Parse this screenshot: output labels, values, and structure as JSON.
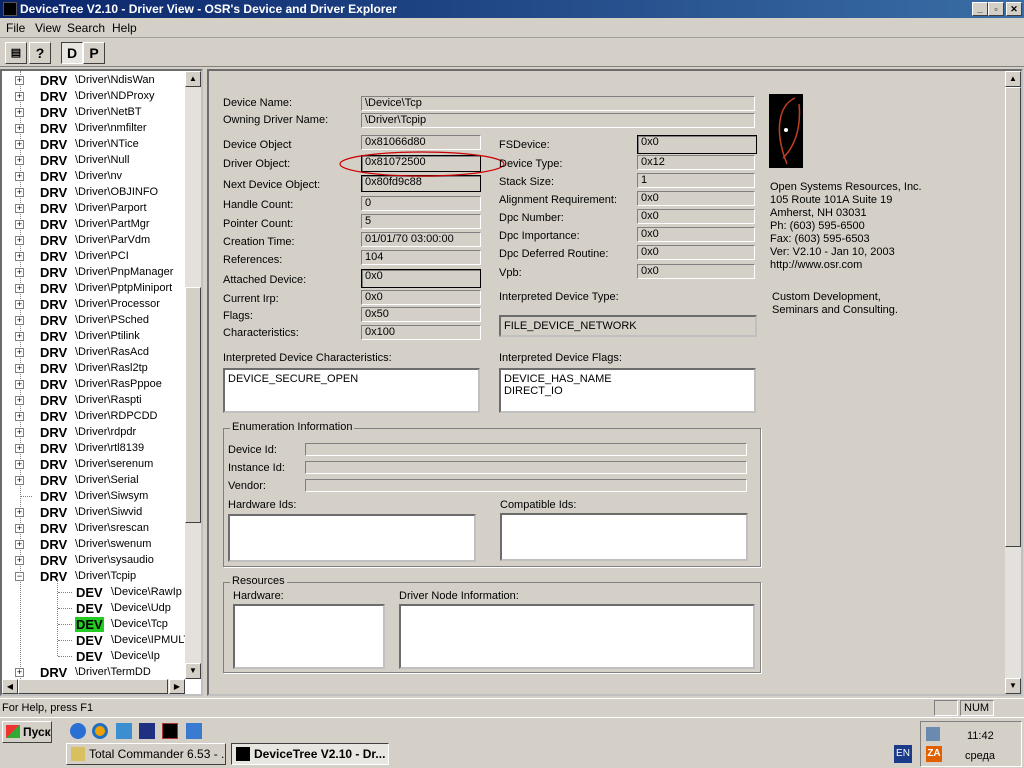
{
  "window": {
    "title": "DeviceTree V2.10 - Driver View - OSR's Device and Driver Explorer"
  },
  "menu": [
    "File",
    "View",
    "Search",
    "Help"
  ],
  "toolbar": {
    "d_label": "D",
    "p_label": "P"
  },
  "tree": {
    "drivers": [
      {
        "kind": "DRV",
        "name": "\\Driver\\NdisWan"
      },
      {
        "kind": "DRV",
        "name": "\\Driver\\NDProxy"
      },
      {
        "kind": "DRV",
        "name": "\\Driver\\NetBT"
      },
      {
        "kind": "DRV",
        "name": "\\Driver\\nmfilter"
      },
      {
        "kind": "DRV",
        "name": "\\Driver\\NTice"
      },
      {
        "kind": "DRV",
        "name": "\\Driver\\Null"
      },
      {
        "kind": "DRV",
        "name": "\\Driver\\nv"
      },
      {
        "kind": "DRV",
        "name": "\\Driver\\OBJINFO"
      },
      {
        "kind": "DRV",
        "name": "\\Driver\\Parport"
      },
      {
        "kind": "DRV",
        "name": "\\Driver\\PartMgr"
      },
      {
        "kind": "DRV",
        "name": "\\Driver\\ParVdm"
      },
      {
        "kind": "DRV",
        "name": "\\Driver\\PCI"
      },
      {
        "kind": "DRV",
        "name": "\\Driver\\PnpManager"
      },
      {
        "kind": "DRV",
        "name": "\\Driver\\PptpMiniport"
      },
      {
        "kind": "DRV",
        "name": "\\Driver\\Processor"
      },
      {
        "kind": "DRV",
        "name": "\\Driver\\PSched"
      },
      {
        "kind": "DRV",
        "name": "\\Driver\\Ptilink"
      },
      {
        "kind": "DRV",
        "name": "\\Driver\\RasAcd"
      },
      {
        "kind": "DRV",
        "name": "\\Driver\\Rasl2tp"
      },
      {
        "kind": "DRV",
        "name": "\\Driver\\RasPppoe"
      },
      {
        "kind": "DRV",
        "name": "\\Driver\\Raspti"
      },
      {
        "kind": "DRV",
        "name": "\\Driver\\RDPCDD"
      },
      {
        "kind": "DRV",
        "name": "\\Driver\\rdpdr"
      },
      {
        "kind": "DRV",
        "name": "\\Driver\\rtl8139"
      },
      {
        "kind": "DRV",
        "name": "\\Driver\\serenum"
      },
      {
        "kind": "DRV",
        "name": "\\Driver\\Serial"
      },
      {
        "kind": "DRV",
        "name": "\\Driver\\Siwsym"
      },
      {
        "kind": "DRV",
        "name": "\\Driver\\Siwvid"
      },
      {
        "kind": "DRV",
        "name": "\\Driver\\srescan"
      },
      {
        "kind": "DRV",
        "name": "\\Driver\\swenum"
      },
      {
        "kind": "DRV",
        "name": "\\Driver\\sysaudio"
      },
      {
        "kind": "DRV",
        "name": "\\Driver\\Tcpip",
        "expanded": true
      },
      {
        "kind": "DEV",
        "name": "\\Device\\RawIp",
        "child": true
      },
      {
        "kind": "DEV",
        "name": "\\Device\\Udp",
        "child": true
      },
      {
        "kind": "DEV",
        "name": "\\Device\\Tcp",
        "child": true,
        "selected": true
      },
      {
        "kind": "DEV",
        "name": "\\Device\\IPMULTICAST",
        "child": true
      },
      {
        "kind": "DEV",
        "name": "\\Device\\Ip",
        "child": true
      },
      {
        "kind": "DRV",
        "name": "\\Driver\\TermDD"
      }
    ]
  },
  "details": {
    "device_name_label": "Device Name:",
    "device_name": "\\Device\\Tcp",
    "owning_driver_label": "Owning Driver Name:",
    "owning_driver": "\\Driver\\Tcpip",
    "device_object_label": "Device Object",
    "device_object": "0x81066d80",
    "driver_object_label": "Driver Object:",
    "driver_object": "0x81072500",
    "next_device_label": "Next Device Object:",
    "next_device": "0x80fd9c88",
    "handle_count_label": "Handle Count:",
    "handle_count": "0",
    "pointer_count_label": "Pointer Count:",
    "pointer_count": "5",
    "creation_time_label": "Creation Time:",
    "creation_time": "01/01/70 03:00:00",
    "references_label": "References:",
    "references": "104",
    "attached_device_label": "Attached Device:",
    "attached_device": "0x0",
    "current_irp_label": "Current Irp:",
    "current_irp": "0x0",
    "flags_label": "Flags:",
    "flags": "0x50",
    "characteristics_label": "Characteristics:",
    "characteristics": "0x100",
    "fsdevice_label": "FSDevice:",
    "fsdevice": "0x0",
    "device_type_label": "Device Type:",
    "device_type": "0x12",
    "stack_size_label": "Stack Size:",
    "stack_size": "1",
    "alignment_label": "Alignment Requirement:",
    "alignment": "0x0",
    "dpc_number_label": "Dpc Number:",
    "dpc_number": "0x0",
    "dpc_importance_label": "Dpc Importance:",
    "dpc_importance": "0x0",
    "dpc_deferred_label": "Dpc Deferred Routine:",
    "dpc_deferred": "0x0",
    "vpb_label": "Vpb:",
    "vpb": "0x0",
    "interp_type_label": "Interpreted Device Type:",
    "interp_type": "FILE_DEVICE_NETWORK",
    "interp_chars_label": "Interpreted Device Characteristics:",
    "interp_chars": "DEVICE_SECURE_OPEN",
    "interp_flags_label": "Interpreted Device Flags:",
    "interp_flags": "DEVICE_HAS_NAME\nDIRECT_IO"
  },
  "enumeration": {
    "title": "Enumeration Information",
    "device_id_label": "Device Id:",
    "instance_id_label": "Instance Id:",
    "vendor_label": "Vendor:",
    "hardware_ids_label": "Hardware Ids:",
    "compatible_ids_label": "Compatible Ids:"
  },
  "resources": {
    "title": "Resources",
    "hardware_label": "Hardware:",
    "driver_node_label": "Driver Node Information:"
  },
  "osr": {
    "lines": [
      "Open Systems Resources, Inc.",
      "105 Route 101A Suite 19",
      "Amherst, NH 03031",
      "Ph: (603) 595-6500",
      "Fax: (603) 595-6503",
      "Ver: V2.10 - Jan 10, 2003",
      "http://www.osr.com"
    ],
    "tagline": "Custom Development,\nSeminars and Consulting."
  },
  "status": {
    "help": "For Help, press F1",
    "num": "NUM"
  },
  "taskbar": {
    "start": "Пуск",
    "tasks": [
      "Total Commander 6.53 - ...",
      "DeviceTree V2.10 - Dr..."
    ],
    "lang": "EN",
    "time": "11:42",
    "day": "среда"
  },
  "colors": {
    "title_start": "#0a246a",
    "title_end": "#3a6ea5",
    "selected_dev": "#22cc22",
    "highlight_ellipse": "#cc0000"
  }
}
